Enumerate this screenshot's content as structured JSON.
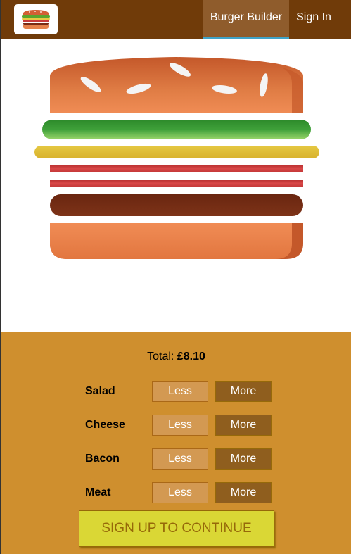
{
  "app": {
    "logo_icon": "burger-logo-icon"
  },
  "nav": {
    "items": [
      {
        "label": "Burger Builder",
        "active": true
      },
      {
        "label": "Sign In",
        "active": false
      }
    ]
  },
  "burger": {
    "layers": [
      "bread-top",
      "salad",
      "cheese",
      "bacon",
      "bacon",
      "meat",
      "bread-bottom"
    ]
  },
  "controls": {
    "total_label": "Total:",
    "total_value": "£8.10",
    "rows": [
      {
        "label": "Salad",
        "less": "Less",
        "more": "More"
      },
      {
        "label": "Cheese",
        "less": "Less",
        "more": "More"
      },
      {
        "label": "Bacon",
        "less": "Less",
        "more": "More"
      },
      {
        "label": "Meat",
        "less": "Less",
        "more": "More"
      }
    ],
    "order_button": "SIGN UP TO CONTINUE"
  },
  "colors": {
    "toolbar": "#703b09",
    "nav_active": "#8f5c2c",
    "nav_active_border": "#40a4c8",
    "controls_bg": "#cf8f2e",
    "order_bg": "#dad735",
    "order_text": "#966909"
  }
}
